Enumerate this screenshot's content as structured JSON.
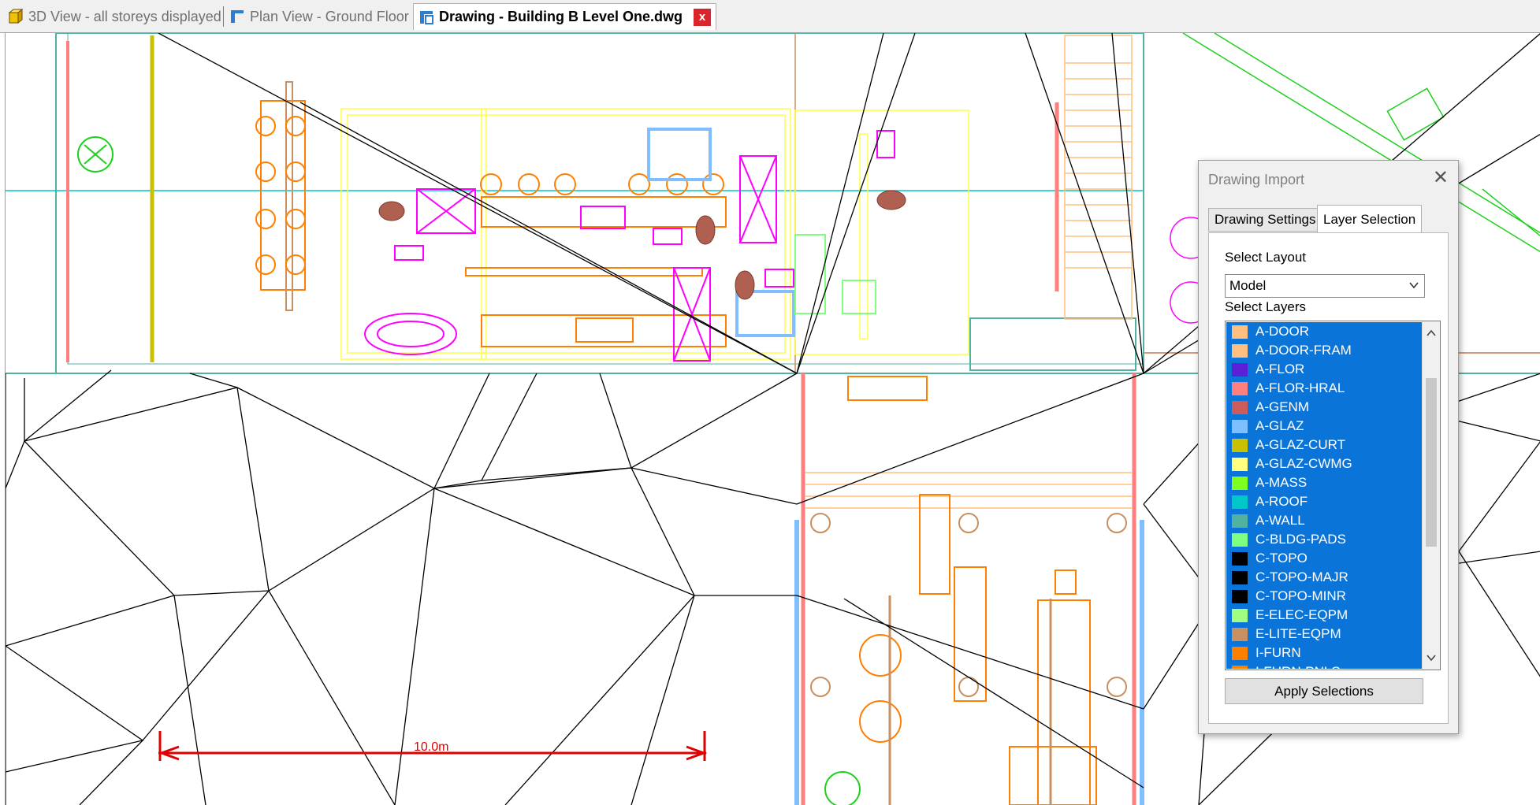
{
  "tabs": [
    {
      "label": "3D View - all storeys displayed",
      "icon": "cube-3d-icon",
      "active": false
    },
    {
      "label": "Plan View - Ground Floor",
      "icon": "plan-view-icon",
      "active": false
    },
    {
      "label": "Drawing - Building B Level One.dwg",
      "icon": "drawing-icon",
      "active": true
    }
  ],
  "tab_close_glyph": "x",
  "canvas": {
    "scale_label": "10.0m"
  },
  "dialog": {
    "title": "Drawing Import",
    "close_glyph": "✕",
    "tabs": [
      "Drawing Settings",
      "Layer Selection"
    ],
    "active_tab": "Layer Selection",
    "select_layout_label": "Select Layout",
    "layout_value": "Model",
    "select_layers_label": "Select Layers",
    "layers": [
      {
        "name": "A-DOOR",
        "color": "#ffbf80"
      },
      {
        "name": "A-DOOR-FRAM",
        "color": "#ffbf80"
      },
      {
        "name": "A-FLOR",
        "color": "#5a1fd6"
      },
      {
        "name": "A-FLOR-HRAL",
        "color": "#ff7f7f"
      },
      {
        "name": "A-GENM",
        "color": "#cc5c5c"
      },
      {
        "name": "A-GLAZ",
        "color": "#7fbfff"
      },
      {
        "name": "A-GLAZ-CURT",
        "color": "#c8c000"
      },
      {
        "name": "A-GLAZ-CWMG",
        "color": "#ffff80"
      },
      {
        "name": "A-MASS",
        "color": "#7fff1f"
      },
      {
        "name": "A-ROOF",
        "color": "#00c8c8"
      },
      {
        "name": "A-WALL",
        "color": "#52b2a2"
      },
      {
        "name": "C-BLDG-PADS",
        "color": "#7fff7f"
      },
      {
        "name": "C-TOPO",
        "color": "#000000"
      },
      {
        "name": "C-TOPO-MAJR",
        "color": "#000000"
      },
      {
        "name": "C-TOPO-MINR",
        "color": "#000000"
      },
      {
        "name": "E-ELEC-EQPM",
        "color": "#a0ff80"
      },
      {
        "name": "E-LITE-EQPM",
        "color": "#c89060"
      },
      {
        "name": "I-FURN",
        "color": "#ff7f00"
      },
      {
        "name": "I-FURN-PNLS",
        "color": "#ff7f00"
      }
    ],
    "apply_label": "Apply Selections"
  }
}
